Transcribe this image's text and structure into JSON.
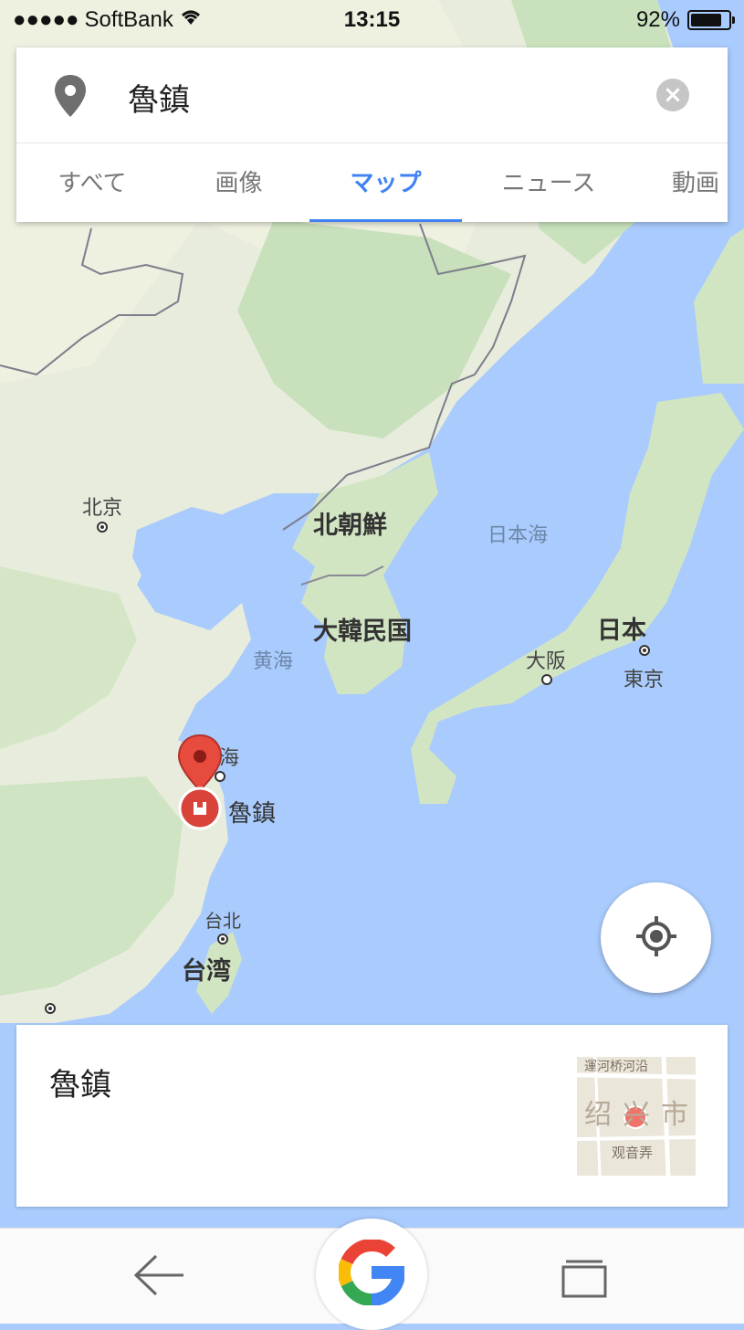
{
  "status_bar": {
    "signal": "●●●●●",
    "carrier": "SoftBank",
    "time": "13:15",
    "battery": "92%",
    "battery_level": 0.92
  },
  "search": {
    "query": "魯鎮",
    "clear_icon": "close-icon",
    "pin_icon": "location-pin-icon"
  },
  "tabs": [
    {
      "label": "すべて"
    },
    {
      "label": "画像"
    },
    {
      "label": "マップ"
    },
    {
      "label": "ニュース"
    },
    {
      "label": "動画"
    }
  ],
  "active_tab": "マップ",
  "map": {
    "labels": {
      "beijing": "北京",
      "north_korea": "北朝鮮",
      "sea_of_japan": "日本海",
      "south_korea": "大韓民国",
      "yellow_sea": "黄海",
      "japan": "日本",
      "osaka": "大阪",
      "tokyo": "東京",
      "shanghai_partial": "海",
      "taipei": "台北",
      "taiwan": "台湾"
    },
    "marker_label": "魯鎮",
    "colors": {
      "water": "#a9cbfd",
      "land": "#e8ecdc",
      "forest": "#c8e1bc",
      "marker": "#d9443a"
    }
  },
  "locate_button": {
    "icon": "my-location-icon"
  },
  "result": {
    "title": "魯鎮",
    "thumbnail": {
      "top_text": "運河桥河沿",
      "city_text": "绍兴市",
      "bottom_text": "观音弄"
    }
  },
  "bottom_bar": {
    "back_icon": "back-arrow-icon",
    "home_icon": "google-g-icon",
    "tabs_icon": "tabs-icon"
  }
}
